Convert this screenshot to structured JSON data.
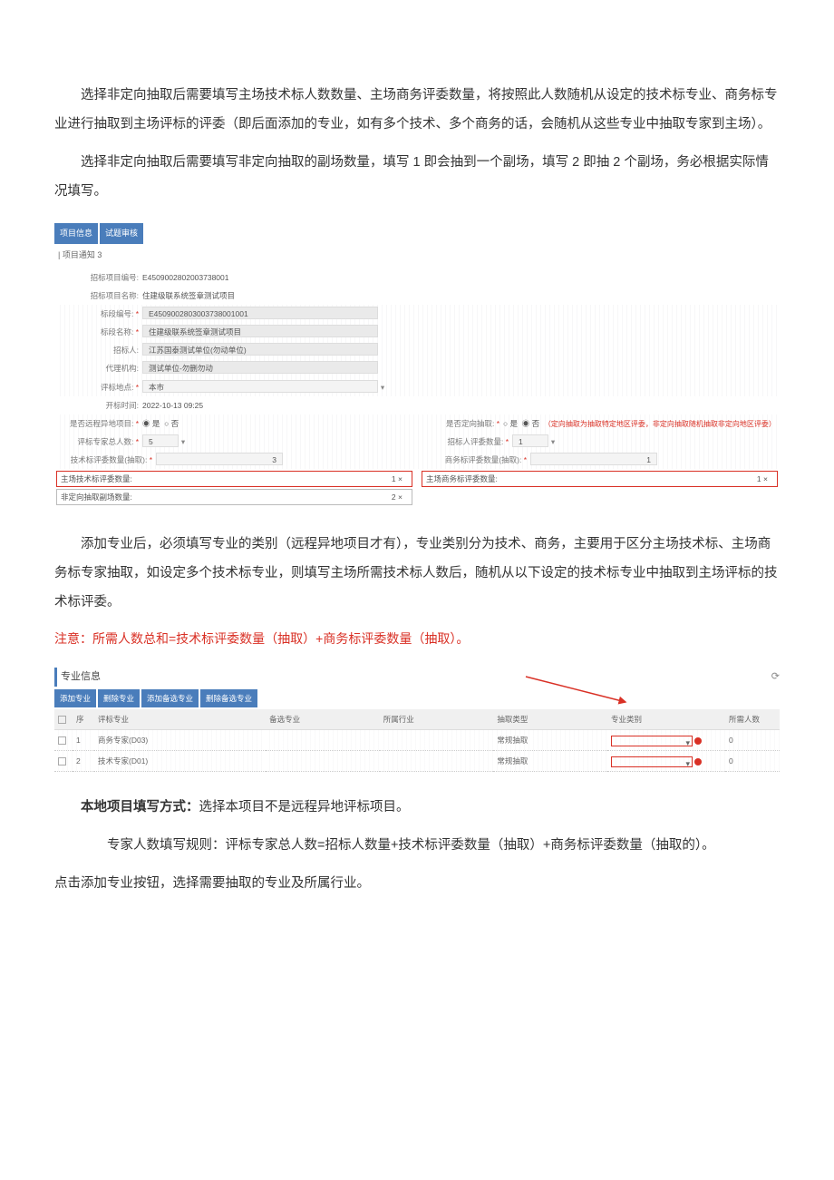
{
  "paragraphs": {
    "p1": "选择非定向抽取后需要填写主场技术标人数数量、主场商务评委数量，将按照此人数随机从设定的技术标专业、商务标专业进行抽取到主场评标的评委（即后面添加的专业，如有多个技术、多个商务的话，会随机从这些专业中抽取专家到主场）。",
    "p2": "选择非定向抽取后需要填写非定向抽取的副场数量，填写 1 即会抽到一个副场，填写 2 即抽 2 个副场，务必根据实际情况填写。",
    "p3": "添加专业后，必须填写专业的类别（远程异地项目才有），专业类别分为技术、商务，主要用于区分主场技术标、主场商务标专家抽取，如设定多个技术标专业，则填写主场所需技术标人数后，随机从以下设定的技术标专业中抽取到主场评标的技术标评委。",
    "p4_red": "注意：所需人数总和=技术标评委数量（抽取）+商务标评委数量（抽取）。",
    "p5_bold": "本地项目填写方式：",
    "p5_tail": "选择本项目不是远程异地评标项目。",
    "p6": "专家人数填写规则：评标专家总人数=招标人数量+技术标评委数量（抽取）+商务标评委数量（抽取的）。",
    "p7": "点击添加专业按钮，选择需要抽取的专业及所属行业。"
  },
  "form1": {
    "tabs": [
      "项目信息",
      "试题审核"
    ],
    "notice": "| 项目通知 3",
    "labels": {
      "projCode": "招标项目编号:",
      "projName": "招标项目名称:",
      "bidCode": "标段编号:",
      "bidName": "标段名称:",
      "owner": "招标人:",
      "agency": "代理机构:",
      "evalAddr": "评标地点:",
      "openTime": "开标时间:",
      "isRemote": "是否远程异地项目:",
      "isDirected": "是否定向抽取:",
      "totalExperts": "评标专家总人数:",
      "ownerRepCount": "招标人评委数量:",
      "techCount": "技术标评委数量(抽取):",
      "bizCount": "商务标评委数量(抽取):",
      "mainTechCount": "主场技术标评委数量:",
      "mainBizCount": "主场商务标评委数量:",
      "subCount": "非定向抽取副场数量:"
    },
    "values": {
      "projCode": "E4509002802003738001",
      "projName": "住建级联系统签章测试项目",
      "bidCode": "E4509002803003738001001",
      "bidName": "住建级联系统签章测试项目",
      "owner": "江苏国泰测试单位(勿动单位)",
      "agency": "测试单位-勿删勿动",
      "evalAddr": "本市",
      "openTime": "2022-10-13 09:25",
      "isRemoteYes": "是",
      "isRemoteNo": "否",
      "isDirectedYes": "是",
      "isDirectedNo": "否",
      "directedHint": "（定向抽取为抽取特定地区评委，非定向抽取随机抽取非定向地区评委）",
      "totalExperts": "5",
      "ownerRepCount": "1",
      "techCount": "3",
      "bizCount": "1",
      "mainTechCount": "1",
      "mainBizCount": "1",
      "subCount": "2"
    },
    "x": "×",
    "caret": "▾"
  },
  "section2": {
    "title": "专业信息",
    "buttons": [
      "添加专业",
      "删除专业",
      "添加备选专业",
      "删除备选专业"
    ],
    "headers": [
      "",
      "序",
      "评标专业",
      "备选专业",
      "所属行业",
      "抽取类型",
      "专业类别",
      "所需人数"
    ],
    "rows": [
      {
        "idx": "1",
        "zy": "商务专家(D03)",
        "type": "常规抽取",
        "need": "0"
      },
      {
        "idx": "2",
        "zy": "技术专家(D01)",
        "type": "常规抽取",
        "need": "0"
      }
    ]
  }
}
